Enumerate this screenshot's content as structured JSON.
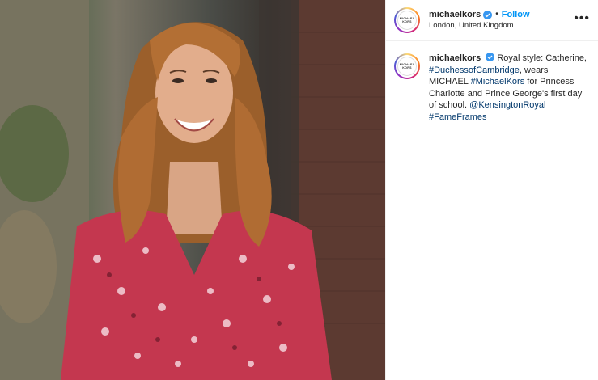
{
  "post": {
    "author": {
      "username": "michaelkors",
      "avatar_text": "MICHAEL KORS",
      "verified": true,
      "location": "London, United Kingdom"
    },
    "follow_label": "Follow",
    "separator": "•",
    "more_label": "•••",
    "caption": {
      "username": "michaelkors",
      "p1": "Royal style: Catherine,",
      "tag1": "#DuchessofCambridge",
      "p2": ", wears MICHAEL",
      "tag2": "#MichaelKors",
      "p3": "for Princess Charlotte and Prince George's first day of school.",
      "mention": "@KensingtonRoyal",
      "tag3": "#FameFrames"
    }
  },
  "colors": {
    "link_blue": "#0095f6",
    "hashtag": "#00376b",
    "verified_badge": "#3897f0"
  },
  "icons": {
    "verified": "verified-badge-icon",
    "more": "more-options-icon"
  }
}
